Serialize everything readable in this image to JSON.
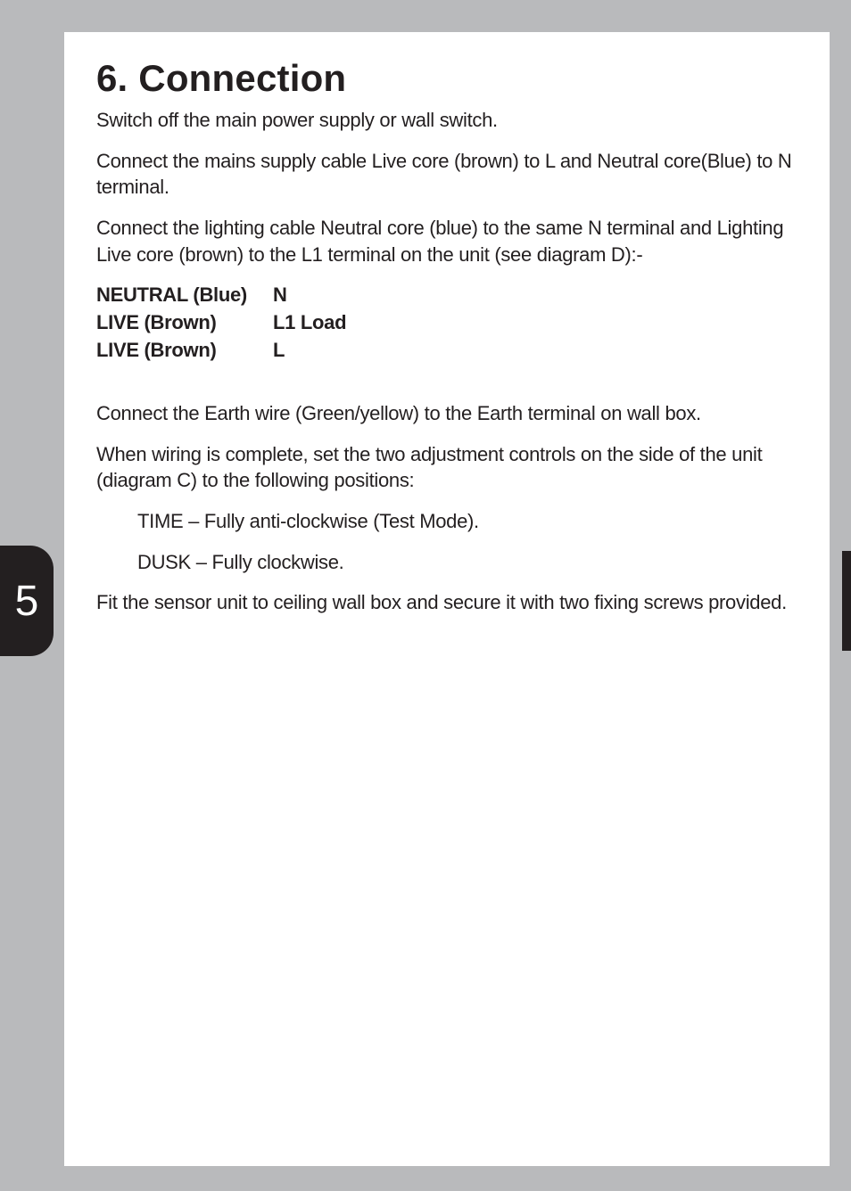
{
  "heading": "6. Connection",
  "p1": "Switch off the main power supply or wall switch.",
  "p2": "Connect the mains supply cable Live core (brown) to L and Neutral core(Blue) to N terminal.",
  "p3": "Connect the lighting cable Neutral core (blue) to the same N terminal and Lighting Live core (brown) to the L1 terminal on the unit (see diagram D):-",
  "table": {
    "r1": {
      "label": "NEUTRAL (Blue)",
      "val": "N"
    },
    "r2": {
      "label": "LIVE (Brown)",
      "val": "L1 Load"
    },
    "r3": {
      "label": "LIVE (Brown)",
      "val": "L"
    }
  },
  "p4": "Connect the Earth wire (Green/yellow) to the Earth terminal on wall box.",
  "p5": "When wiring is complete, set the two adjustment controls on the side of the unit (diagram C) to the following positions:",
  "indent1": "TIME – Fully anti-clockwise (Test Mode).",
  "indent2": "DUSK – Fully clockwise.",
  "p6": "Fit the sensor unit to ceiling wall box and secure it with two fixing screws provided.",
  "page_number": "5"
}
